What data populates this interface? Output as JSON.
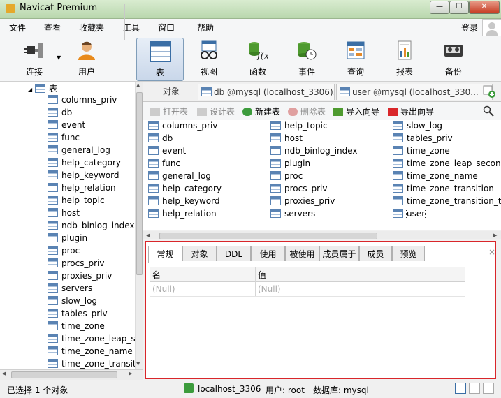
{
  "window": {
    "title": "Navicat Premium",
    "controls": [
      "—",
      "☐",
      "✕"
    ]
  },
  "menu": {
    "items": [
      "文件",
      "查看",
      "收藏夹",
      "工具",
      "窗口",
      "帮助"
    ],
    "login": "登录",
    "overflow": "»"
  },
  "toolbar": {
    "items": [
      "连接",
      "用户",
      "表",
      "视图",
      "函数",
      "事件",
      "查询",
      "报表",
      "备份"
    ],
    "active": "表"
  },
  "tree": {
    "header": "表",
    "items": [
      "columns_priv",
      "db",
      "event",
      "func",
      "general_log",
      "help_category",
      "help_keyword",
      "help_relation",
      "help_topic",
      "host",
      "ndb_binlog_index",
      "plugin",
      "proc",
      "procs_priv",
      "proxies_priv",
      "servers",
      "slow_log",
      "tables_priv",
      "time_zone",
      "time_zone_leap_sec",
      "time_zone_name",
      "time_zone_transiti"
    ]
  },
  "tabs": {
    "objects": "对象",
    "tab1": "db @mysql (localhost_3306)...",
    "tab2": "user @mysql (localhost_330..."
  },
  "object_toolbar": {
    "open": "打开表",
    "design": "设计表",
    "new": "新建表",
    "delete": "删除表",
    "import": "导入向导",
    "export": "导出向导"
  },
  "objects": {
    "col1": [
      "columns_priv",
      "db",
      "event",
      "func",
      "general_log",
      "help_category",
      "help_keyword",
      "help_relation"
    ],
    "col2": [
      "help_topic",
      "host",
      "ndb_binlog_index",
      "plugin",
      "proc",
      "procs_priv",
      "proxies_priv",
      "servers"
    ],
    "col3": [
      "slow_log",
      "tables_priv",
      "time_zone",
      "time_zone_leap_second",
      "time_zone_name",
      "time_zone_transition",
      "time_zone_transition_typ",
      "user"
    ]
  },
  "info": {
    "tabs": [
      "常规",
      "对象",
      "DDL",
      "使用",
      "被使用",
      "成员属于",
      "成员",
      "预览"
    ],
    "headers": {
      "name": "名",
      "value": "值"
    },
    "row": {
      "name": "(Null)",
      "value": "(Null)"
    },
    "close": "×"
  },
  "status": {
    "selection": "已选择 1 个对象",
    "connection": "localhost_3306",
    "user": "用户: root",
    "database": "数据库: mysql"
  },
  "colors": {
    "accent": "#d9262a",
    "title_bar": "#c9e2bf",
    "icon_blue": "#3a6ea5"
  }
}
